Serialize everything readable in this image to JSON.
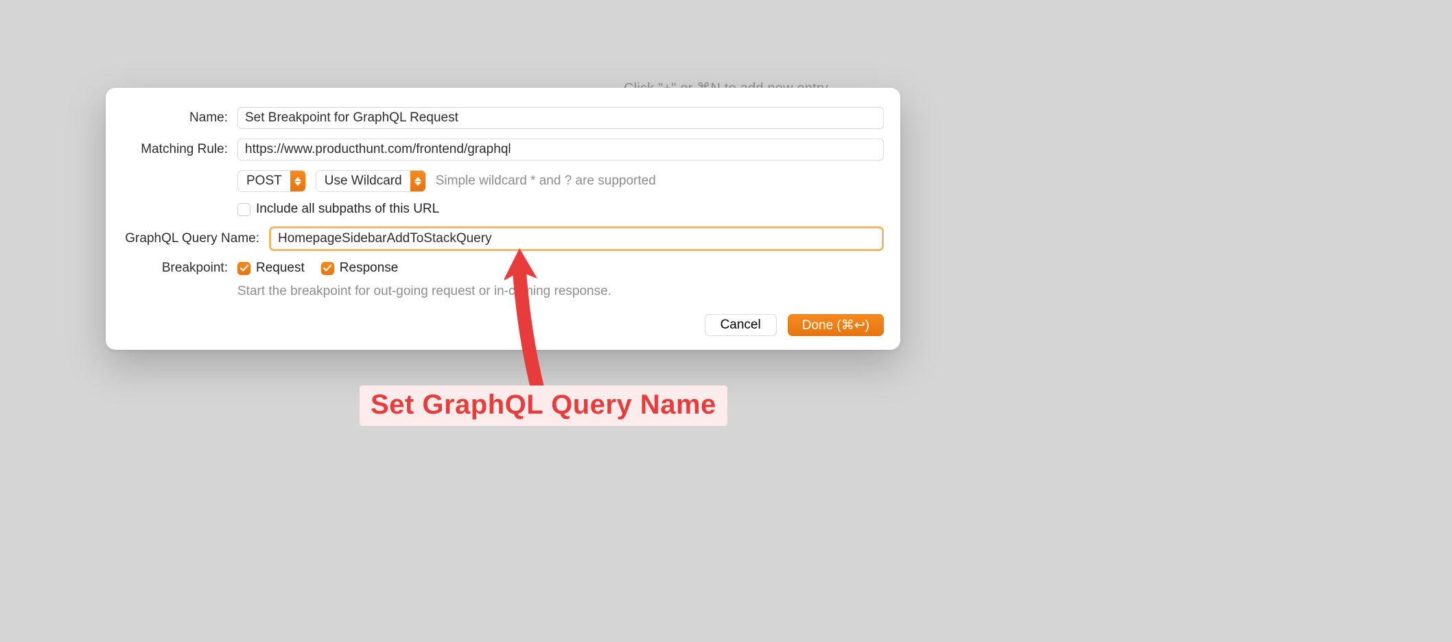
{
  "background_hint": "Click \"+\" or ⌘N to add new entry",
  "labels": {
    "name": "Name:",
    "matching_rule": "Matching Rule:",
    "graphql": "GraphQL Query Name:",
    "breakpoint": "Breakpoint:"
  },
  "fields": {
    "name_value": "Set Breakpoint for GraphQL Request",
    "matching_rule_value": "https://www.producthunt.com/frontend/graphql",
    "graphql_value": "HomepageSidebarAddToStackQuery"
  },
  "selects": {
    "method": "POST",
    "wildcard": "Use Wildcard"
  },
  "hints": {
    "wildcard": "Simple wildcard * and ? are supported",
    "include_subpaths": "Include all subpaths of this URL",
    "breakpoint_note": "Start the breakpoint for out-going request or in-coming response."
  },
  "checkboxes": {
    "include_subpaths": false,
    "request": true,
    "response": true,
    "request_label": "Request",
    "response_label": "Response"
  },
  "buttons": {
    "cancel": "Cancel",
    "done": "Done (⌘↩︎)"
  },
  "annotation": {
    "caption": "Set GraphQL Query Name"
  },
  "colors": {
    "accent": "#ef7c13",
    "annotation": "#e83c3c",
    "highlight_border": "#f2b867"
  }
}
